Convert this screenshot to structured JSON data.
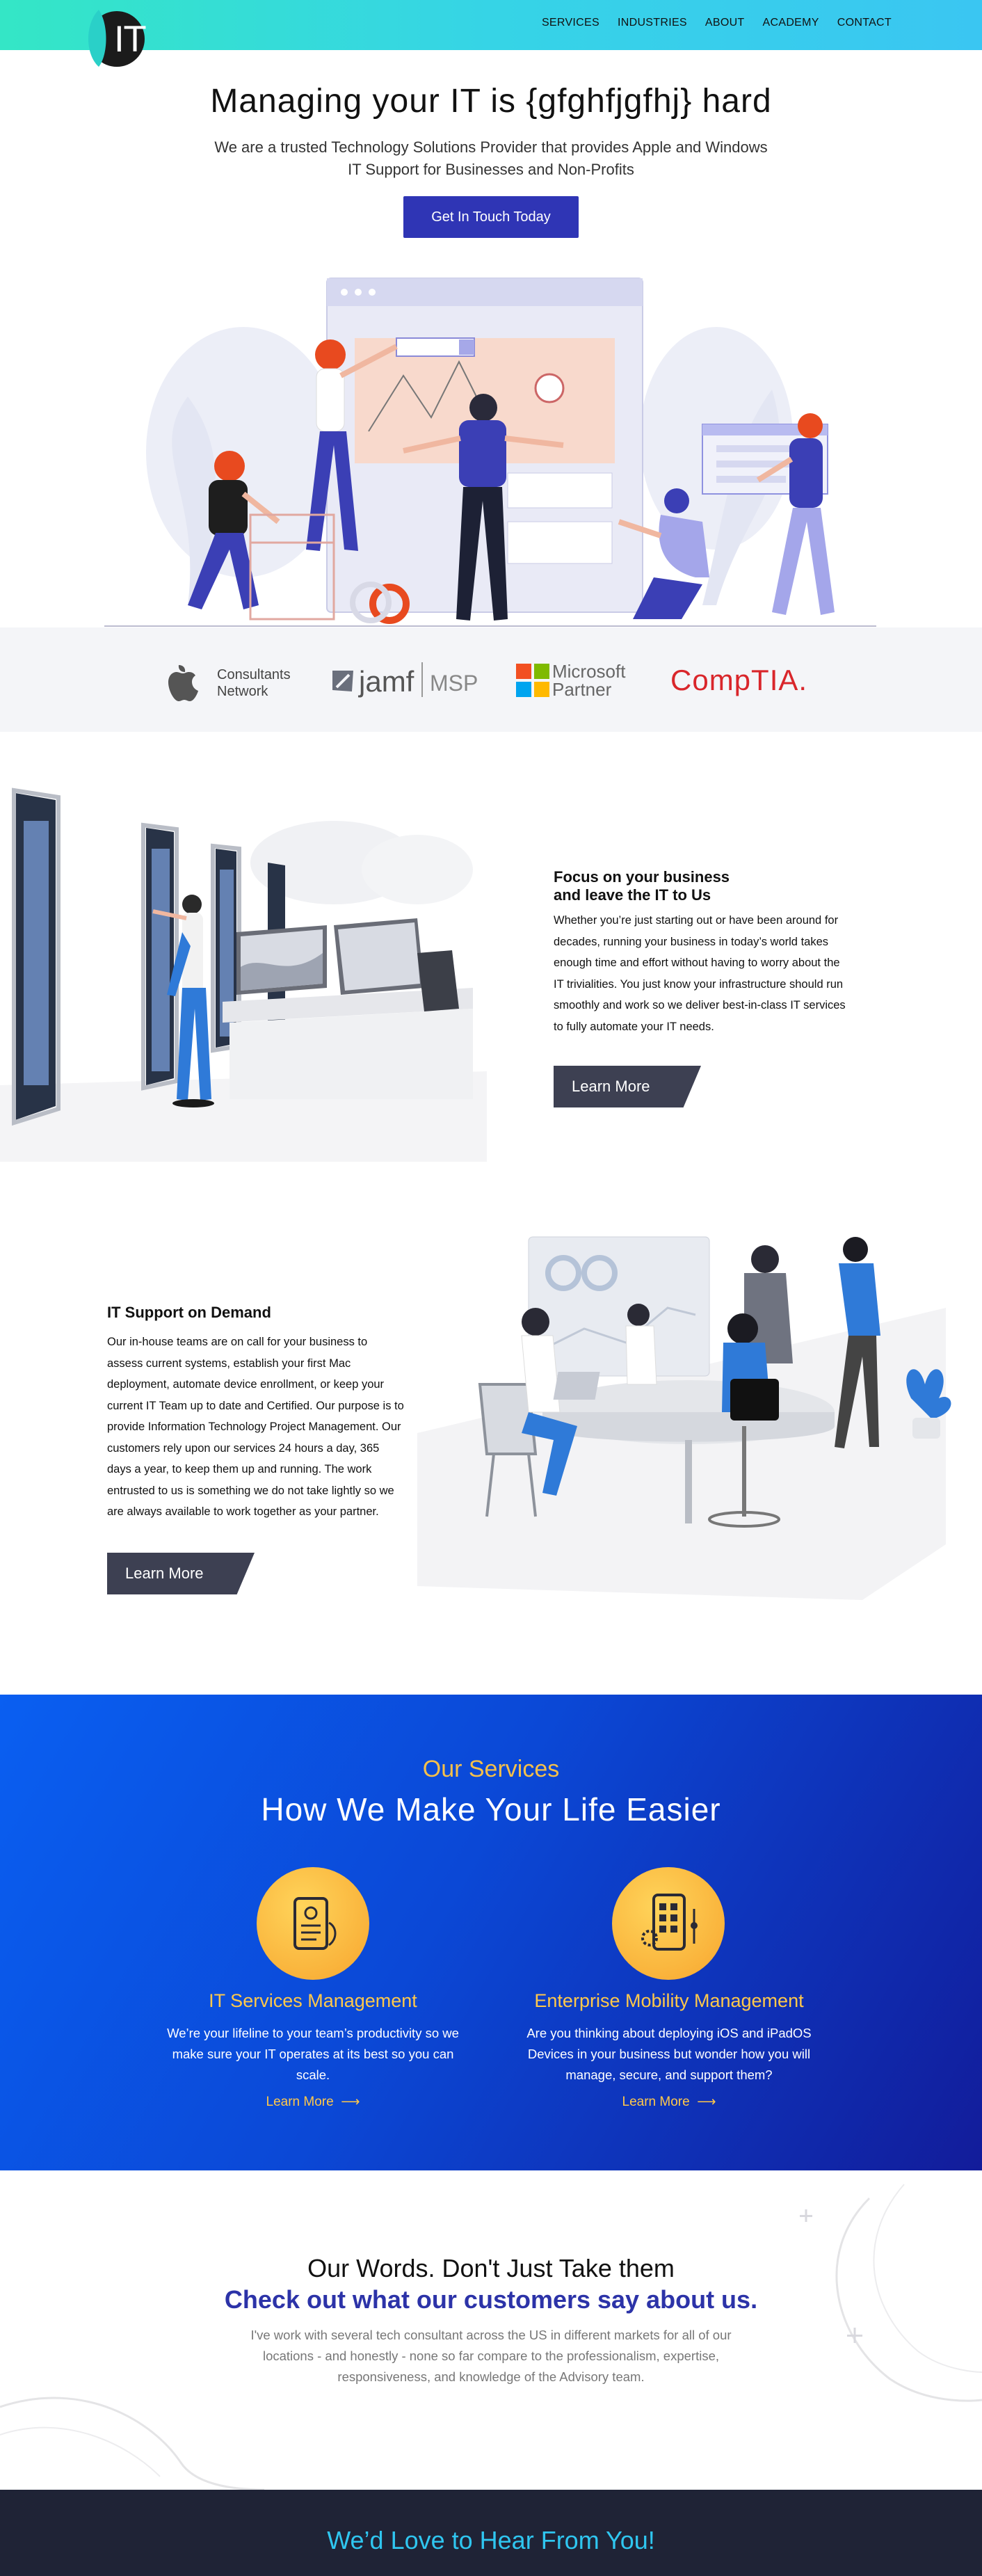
{
  "header": {
    "logo_text": "IT",
    "nav": [
      "SERVICES",
      "INDUSTRIES",
      "ABOUT",
      "ACADEMY",
      "CONTACT"
    ]
  },
  "hero": {
    "title": "Managing your IT is {gfghfjgfhj} hard",
    "subtitle": "We are a trusted Technology Solutions Provider that provides Apple and Windows IT Support for Businesses and Non-Profits",
    "cta": "Get In Touch Today"
  },
  "partners": {
    "apple_line1": "Consultants",
    "apple_line2": "Network",
    "jamf": "jamf",
    "jamf_suffix": "MSP",
    "ms_line1": "Microsoft",
    "ms_line2": "Partner",
    "comptia": "CompTIA."
  },
  "focus": {
    "heading_line1": "Focus on your business",
    "heading_line2": "and leave the IT to Us",
    "body": "Whether you’re just starting out or have been around for decades, running your business in today’s world takes enough time and effort without having to worry about the IT trivialities. You just know your infrastructure should run smoothly and work so we deliver best-in-class IT services to fully automate your IT needs.",
    "button": "Learn More"
  },
  "support": {
    "heading": "IT Support on Demand",
    "body": "Our in-house teams are on call for your business to assess current systems, establish your first Mac deployment, automate device enrollment, or keep your current IT Team up to date and Certified. Our purpose is to provide Information Technology Project Management. Our customers rely upon our services 24 hours a day, 365 days a year, to keep them up and running. The work entrusted to us is something we do not take lightly so we are always available to work together as your partner.",
    "button": "Learn More"
  },
  "services": {
    "eyebrow": "Our Services",
    "title": "How We Make Your Life Easier",
    "items": [
      {
        "title": "IT Services Management",
        "body": "We’re your lifeline to your team’s productivity so we make sure your IT operates at its best so you can scale.",
        "link": "Learn More",
        "icon": "clipboard-device-icon"
      },
      {
        "title": "Enterprise Mobility Management",
        "body": "Are you thinking about deploying iOS and iPadOS Devices in your business but wonder how you will manage, secure, and support them?",
        "link": "Learn More",
        "icon": "mobile-gear-icon"
      }
    ]
  },
  "testimonials": {
    "heading1": "Our Words. Don't Just Take them",
    "heading2": "Check out what our customers say about us.",
    "quote": "I've work with several tech consultant across the US in different markets for all of our locations - and honestly - none so far compare to the professionalism, expertise, responsiveness, and knowledge of the Advisory team."
  },
  "footer": {
    "heading": "We’d Love to Hear From You!"
  },
  "colors": {
    "header_gradient_start": "#34e6c6",
    "header_gradient_end": "#3ac6f2",
    "primary": "#2f35b5",
    "button_dark": "#3d4052",
    "services_blue": "#0b48d6",
    "accent_yellow": "#ffc84a",
    "footer_bg": "#1f2336",
    "footer_heading": "#2fc6f0"
  }
}
